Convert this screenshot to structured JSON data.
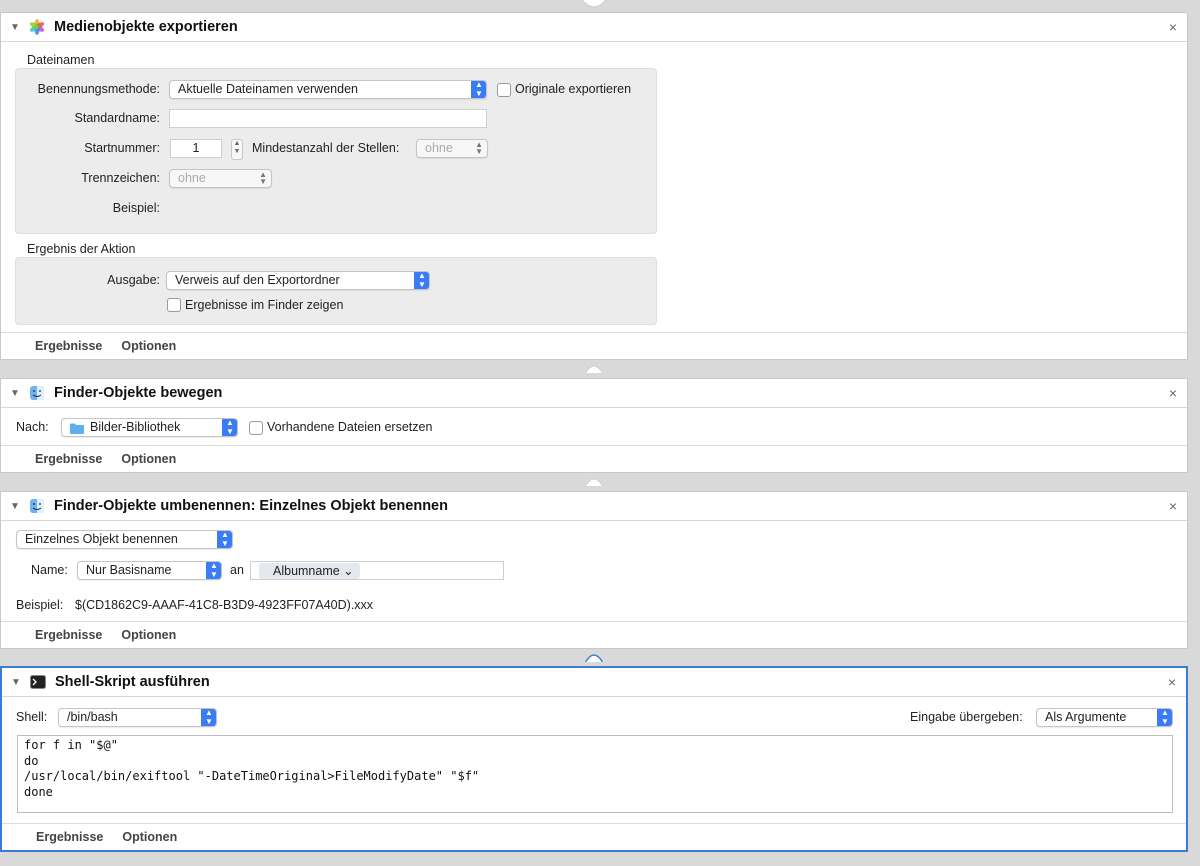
{
  "cards": {
    "export": {
      "title": "Medienobjekte exportieren",
      "section_filenames": "Dateinamen",
      "naming_method_label": "Benennungsmethode:",
      "naming_method_value": "Aktuelle Dateinamen verwenden",
      "export_originals_label": "Originale exportieren",
      "default_name_label": "Standardname:",
      "start_number_label": "Startnummer:",
      "start_number_value": "1",
      "min_digits_label": "Mindestanzahl der Stellen:",
      "min_digits_value": "ohne",
      "separator_label": "Trennzeichen:",
      "separator_value": "ohne",
      "example_label": "Beispiel:",
      "section_result": "Ergebnis der Aktion",
      "output_label": "Ausgabe:",
      "output_value": "Verweis auf den Exportordner",
      "show_in_finder_label": "Ergebnisse im Finder zeigen",
      "footer_results": "Ergebnisse",
      "footer_options": "Optionen"
    },
    "move": {
      "title": "Finder-Objekte bewegen",
      "to_label": "Nach:",
      "to_value": "Bilder-Bibliothek",
      "replace_label": "Vorhandene Dateien ersetzen",
      "footer_results": "Ergebnisse",
      "footer_options": "Optionen"
    },
    "rename": {
      "title": "Finder-Objekte umbenennen: Einzelnes Objekt benennen",
      "mode_value": "Einzelnes Objekt benennen",
      "name_label": "Name:",
      "name_value": "Nur Basisname",
      "at_label": "an",
      "token_value": "Albumname ⌄",
      "example_label": "Beispiel:",
      "example_value": "$(CD1862C9-AAAF-41C8-B3D9-4923FF07A40D).xxx",
      "footer_results": "Ergebnisse",
      "footer_options": "Optionen"
    },
    "shell": {
      "title": "Shell-Skript ausführen",
      "shell_label": "Shell:",
      "shell_value": "/bin/bash",
      "input_label": "Eingabe übergeben:",
      "input_value": "Als Argumente",
      "script_lines": [
        "for f in \"$@\"",
        "do",
        "/usr/local/bin/exiftool \"-DateTimeOriginal>FileModifyDate\" \"$f\"",
        "done"
      ],
      "footer_results": "Ergebnisse",
      "footer_options": "Optionen"
    }
  },
  "glyphs": {
    "disclosure": "▼",
    "close": "×",
    "stepper": "⌃⌄"
  },
  "icons": [
    "photos-icon",
    "finder-icon",
    "terminal-icon",
    "folder-icon"
  ],
  "colors": {
    "accent": "#3a7cf5",
    "selection_border": "#3a7bd5"
  }
}
